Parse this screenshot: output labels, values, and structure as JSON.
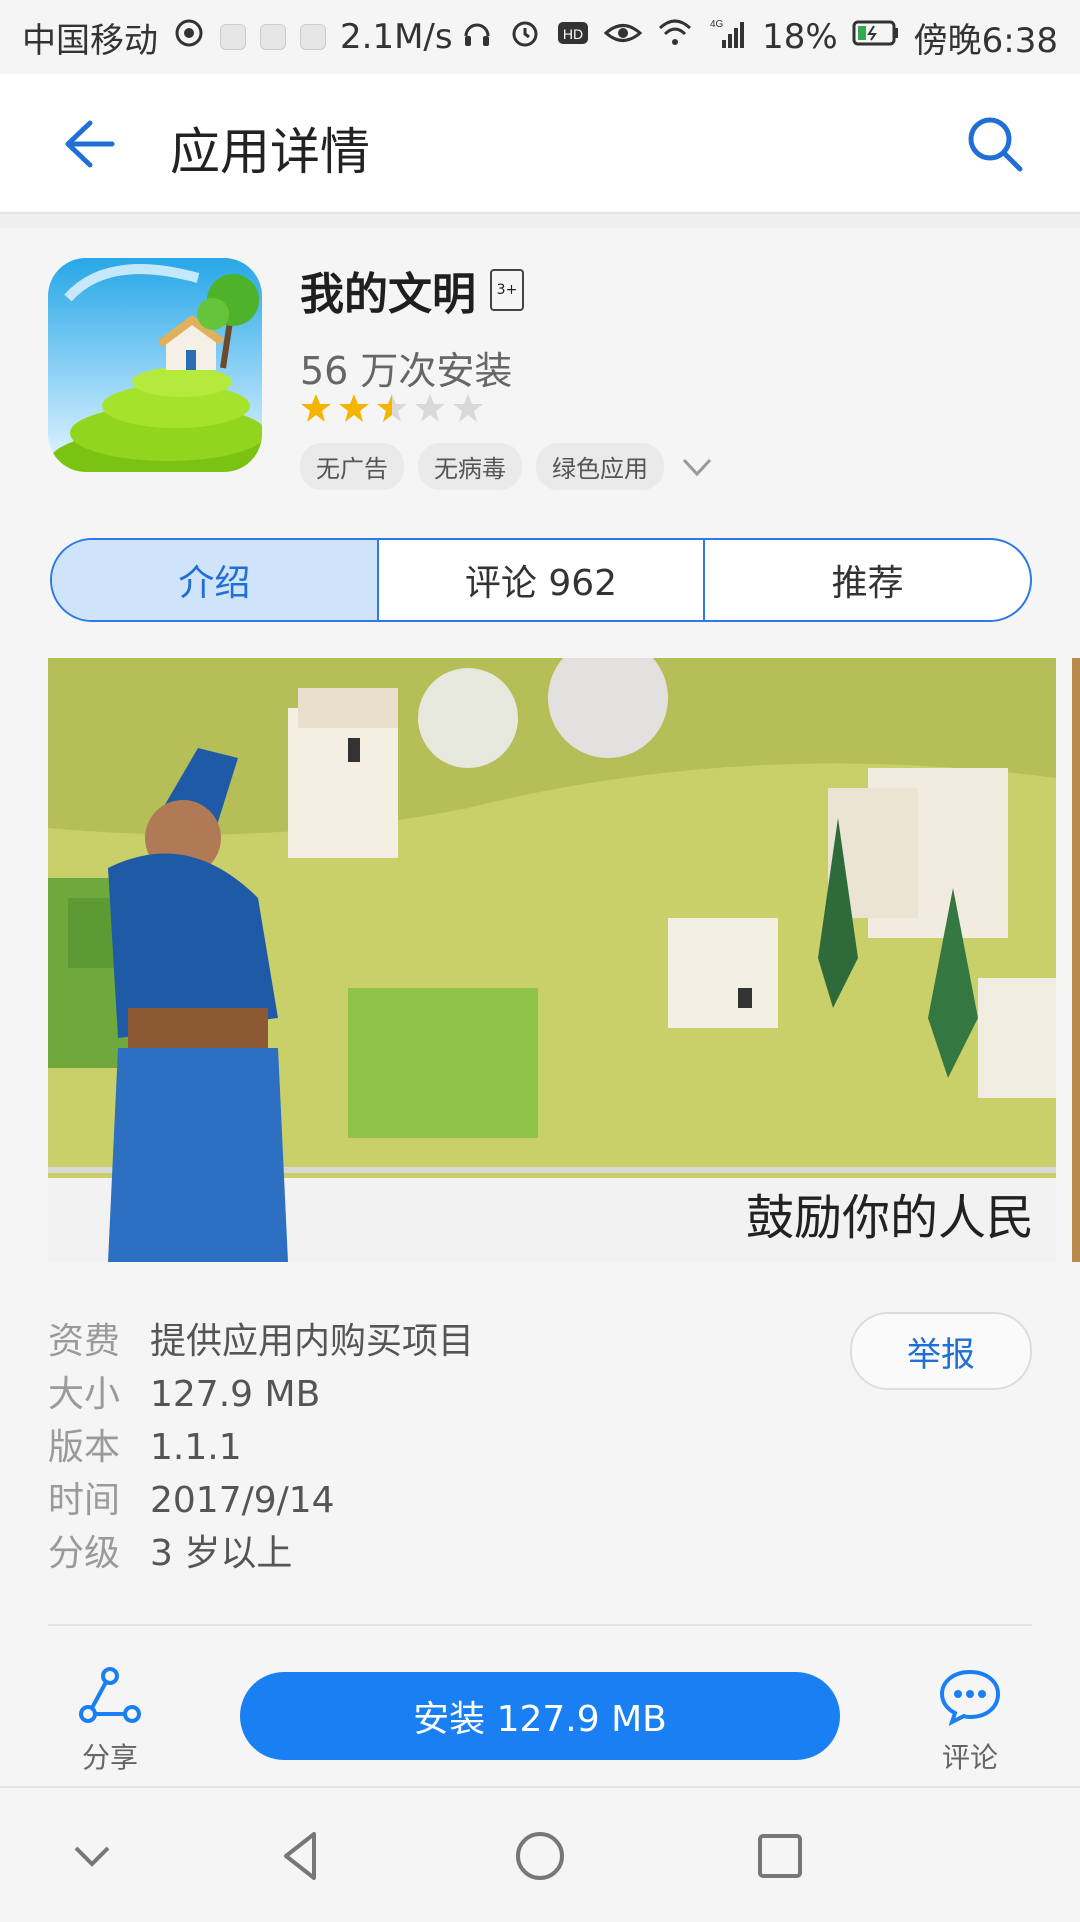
{
  "status_bar": {
    "carrier": "中国移动",
    "speed": "2.1M/s",
    "network": "4G",
    "battery": "18%",
    "time": "傍晚6:38"
  },
  "app_bar": {
    "title": "应用详情",
    "back_icon": "back-arrow-icon",
    "search_icon": "search-icon"
  },
  "app": {
    "name": "我的文明",
    "rating_badge": "3+",
    "installs": "56 万次安装",
    "rating_stars": 2.5,
    "tags": [
      "无广告",
      "无病毒",
      "绿色应用"
    ]
  },
  "tabs": [
    {
      "label": "介绍",
      "active": true
    },
    {
      "label": "评论 962",
      "active": false
    },
    {
      "label": "推荐",
      "active": false
    }
  ],
  "screenshot": {
    "caption": "鼓励你的人民"
  },
  "info": [
    {
      "label": "资费",
      "value": "提供应用内购买项目"
    },
    {
      "label": "大小",
      "value": "127.9 MB"
    },
    {
      "label": "版本",
      "value": "1.1.1"
    },
    {
      "label": "时间",
      "value": "2017/9/14"
    },
    {
      "label": "分级",
      "value": "3 岁以上"
    }
  ],
  "report_label": "举报",
  "bottom": {
    "share_label": "分享",
    "install_label": "安装 127.9 MB",
    "comment_label": "评论"
  },
  "colors": {
    "accent": "#1a7ff3",
    "tab_active_bg": "#cfe3fb",
    "star_filled": "#f5b400",
    "star_empty": "#d9d9d9"
  }
}
